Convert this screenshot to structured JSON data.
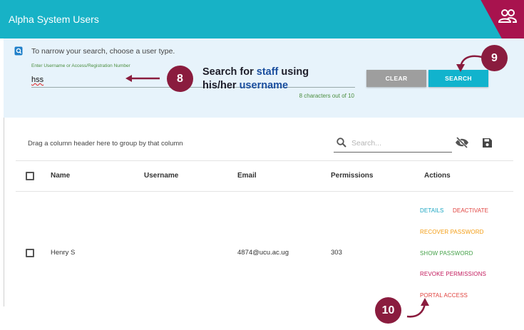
{
  "app": {
    "title": "Alpha System Users"
  },
  "filter": {
    "hint": "To narrow your search, choose a user type.",
    "field_label": "Enter Username or Access/Registration Number",
    "value": "hss",
    "char_count": "8 characters out of 10",
    "clear_label": "CLEAR",
    "search_label": "SEARCH"
  },
  "annotations": {
    "step8": "8",
    "step9": "9",
    "step10": "10",
    "callout_part1": "Search for ",
    "callout_hl1": "staff",
    "callout_part2": " using",
    "callout_line2_part1": "his/her ",
    "callout_hl2": "username",
    "marker_color": "#8a1c3e"
  },
  "grid": {
    "group_hint": "Drag a column header here to group by that column",
    "search_placeholder": "Search...",
    "columns": [
      "Name",
      "Username",
      "Email",
      "Permissions",
      "Actions"
    ],
    "rows": [
      {
        "name": "Henry S",
        "username": "",
        "email": "4874@ucu.ac.ug",
        "permissions": "303",
        "actions": {
          "details": "DETAILS",
          "deactivate": "DEACTIVATE",
          "recover": "RECOVER PASSWORD",
          "show": "SHOW PASSWORD",
          "revoke": "REVOKE PERMISSIONS",
          "portal": "PORTAL ACCESS"
        }
      }
    ]
  },
  "colors": {
    "header": "#17b2c6",
    "corner_accent": "#a8134e",
    "panel_bg": "#e7f3fb",
    "search_button": "#11b3cd",
    "clear_button": "#9e9e9e"
  },
  "icons": [
    "users-icon",
    "info-icon",
    "search-icon",
    "eye-off-icon",
    "save-icon"
  ]
}
